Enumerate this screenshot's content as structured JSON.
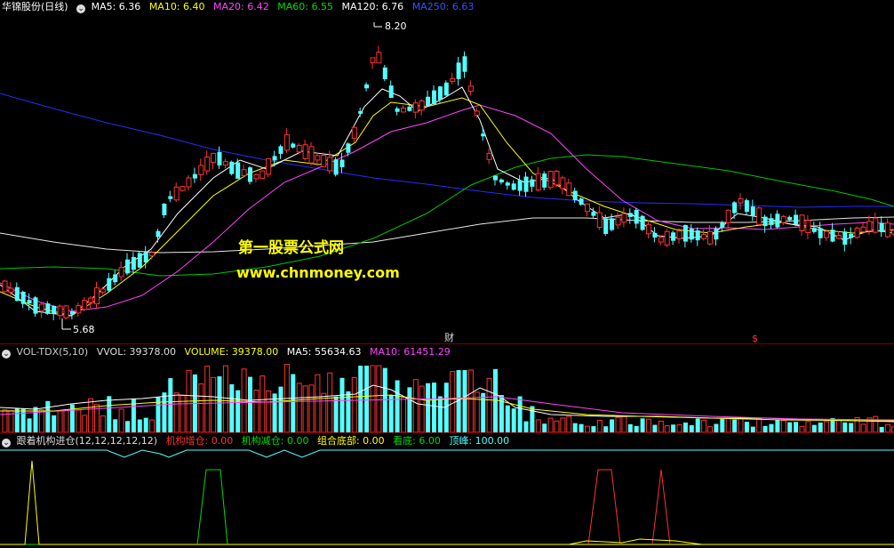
{
  "price_header": {
    "title": "华锦股份(日线)",
    "ma5": "MA5: 6.36",
    "ma10": "MA10: 6.40",
    "ma20": "MA20: 6.42",
    "ma60": "MA60: 6.55",
    "ma120": "MA120: 6.76",
    "ma250": "MA250: 6.63"
  },
  "price_annotations": {
    "high": "8.20",
    "low": "5.68",
    "marker_cai": "财",
    "marker_s": "$"
  },
  "watermark": {
    "line1": "第一股票公式网",
    "line2": "www.chnmoney.com"
  },
  "volume_header": {
    "name": "VOL-TDX(5,10)",
    "vvol": "VVOL: 39378.00",
    "volume": "VOLUME: 39378.00",
    "ma5": "MA5: 55634.63",
    "ma10": "MA10: 61451.29"
  },
  "indicator_header": {
    "name": "跟着机构进仓(12,12,12,12,12)",
    "inst_buy": "机构增仓: 0.00",
    "inst_sell": "机构减仓: 0.00",
    "combo_bottom": "组合底部: 0.00",
    "see_bottom": "看底: 6.00",
    "top": "顶峰: 100.00"
  },
  "colors": {
    "up": "#ff3232",
    "down": "#54ffff",
    "ma5": "#ffffff",
    "ma10": "#ffff00",
    "ma20": "#ff44ff",
    "ma60": "#00dd00",
    "ma120": "#ffffff",
    "ma250": "#3333ff"
  },
  "icons": [
    "collapse-circle-icon"
  ]
}
